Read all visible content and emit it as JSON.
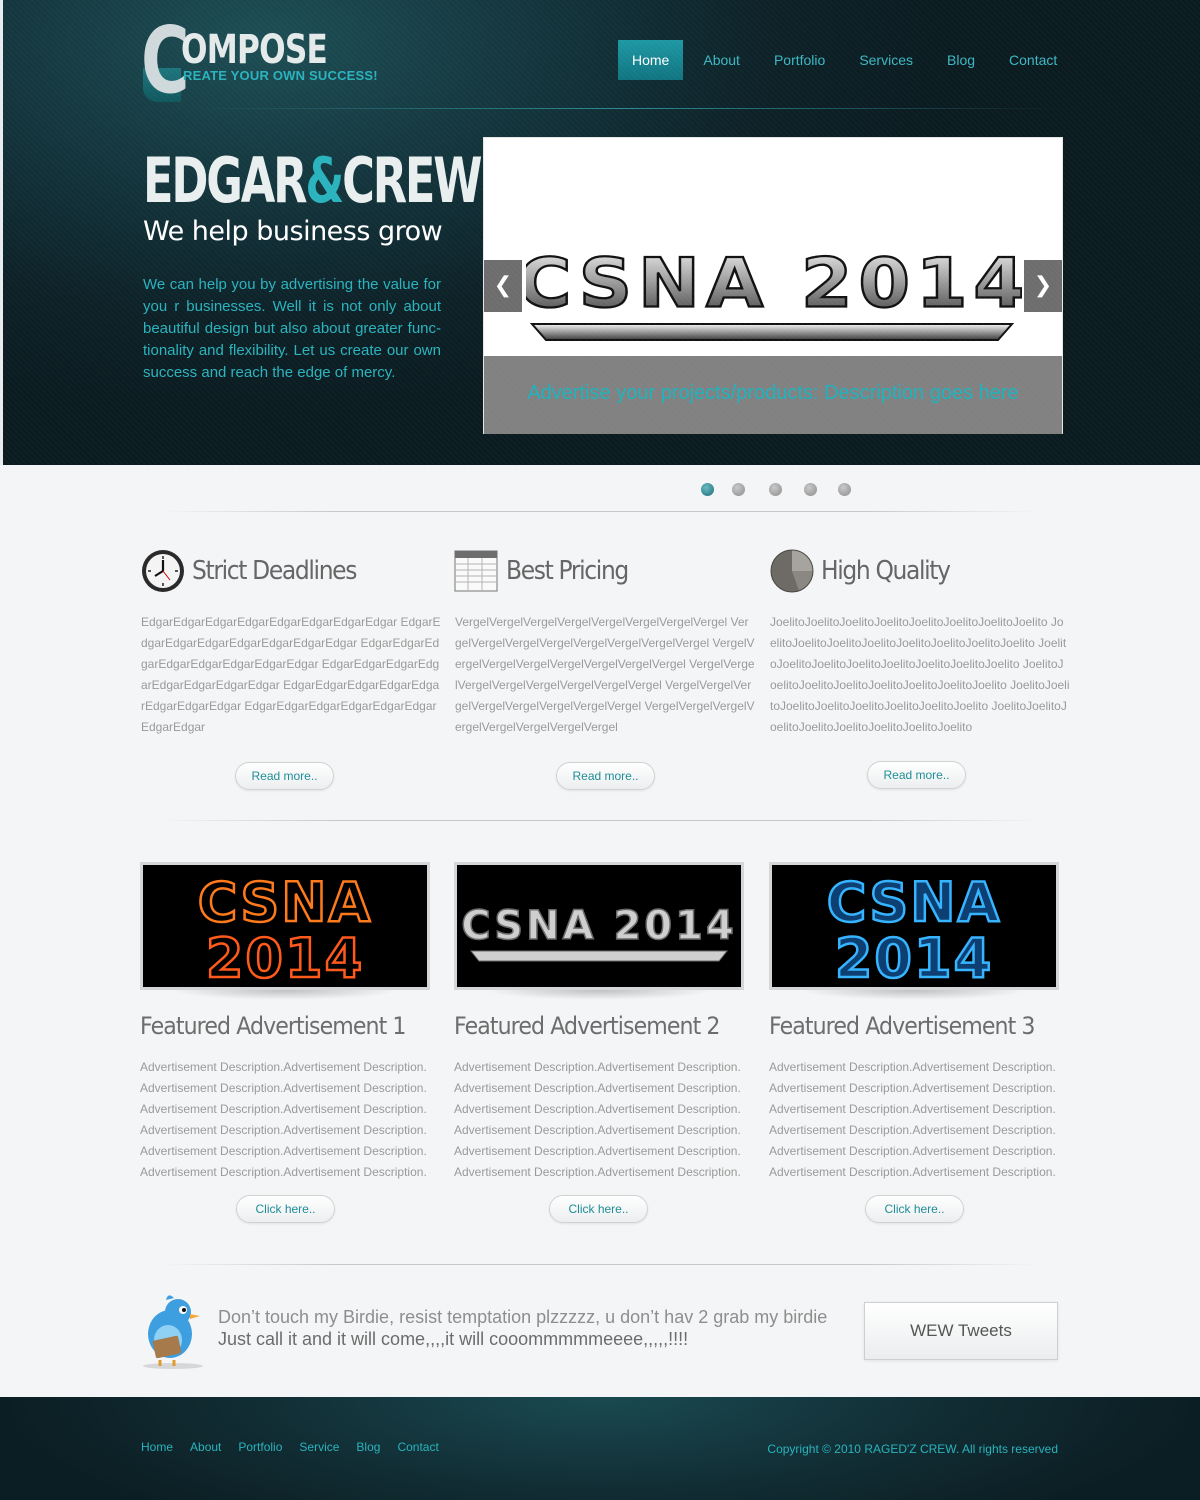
{
  "brand": {
    "logo_letter": "C",
    "logo_rest": "OMPOSE",
    "tagline": "REATE YOUR OWN SUCCESS!"
  },
  "nav": {
    "items": [
      {
        "label": "Home",
        "active": true
      },
      {
        "label": "About",
        "active": false
      },
      {
        "label": "Portfolio",
        "active": false
      },
      {
        "label": "Services",
        "active": false
      },
      {
        "label": "Blog",
        "active": false
      },
      {
        "label": "Contact",
        "active": false
      }
    ]
  },
  "hero": {
    "title_left": "EDGAR",
    "title_amp": "&",
    "title_right": "CREW",
    "subtitle": "We help business grow",
    "body": "We can help you by advertising the value for you r businesses.  Well  it  is not only  about beautiful design but also about greater func- tionality and flexibility. Let us create our own success and reach the edge of mercy."
  },
  "slider": {
    "image_text": "CSNA 2014",
    "caption": "Advertise your projects/products: Description goes here",
    "prev_glyph": "❮",
    "next_glyph": "❯",
    "slide_count": 5,
    "active_slide": 1
  },
  "features": [
    {
      "icon": "clock-icon",
      "title": "Strict Deadlines",
      "body": "EdgarEdgarEdgarEdgarEdgarEdgarEdgarEdgar EdgarEdgarEdgarEdgarEdgarEdgarEdgarEdgar EdgarEdgarEdgarEdgarEdgarEdgarEdgarEdgar EdgarEdgarEdgarEdgarEdgarEdgarEdgarEdgar EdgarEdgarEdgarEdgarEdgarEdgarEdgarEdgar EdgarEdgarEdgarEdgarEdgarEdgarEdgarEdgar",
      "button": "Read more.."
    },
    {
      "icon": "spreadsheet-icon",
      "title": "Best Pricing",
      "body": "VergelVergelVergelVergelVergelVergelVergelVergel VergelVergelVergelVergelVergelVergelVergelVergel VergelVergelVergelVergelVergelVergelVergelVergel VergelVergelVergelVergelVergelVergelVergelVergel VergelVergelVergelVergelVergelVergelVergelVergel VergelVergelVergelVergelVergelVergelVergelVergel",
      "button": "Read more.."
    },
    {
      "icon": "pie-chart-icon",
      "title": "High Quality",
      "body": "JoelitoJoelitoJoelitoJoelitoJoelitoJoelitoJoelitoJoelito JoelitoJoelitoJoelitoJoelitoJoelitoJoelitoJoelitoJoelito JoelitoJoelitoJoelitoJoelitoJoelitoJoelitoJoelitoJoelito JoelitoJoelitoJoelitoJoelitoJoelitoJoelitoJoelitoJoelito JoelitoJoelitoJoelitoJoelitoJoelitoJoelitoJoelitoJoelito JoelitoJoelitoJoelitoJoelitoJoelitoJoelitoJoelitoJoelito",
      "button": "Read more.."
    }
  ],
  "ads": [
    {
      "image_line1": "CSNA",
      "image_line2": "2014",
      "image_color": "#ff7a1c",
      "title": "Featured  Advertisement 1",
      "desc": "Advertisement Description.Advertisement Description. Advertisement Description.Advertisement Description. Advertisement Description.Advertisement Description. Advertisement Description.Advertisement Description. Advertisement Description.Advertisement Description. Advertisement Description.Advertisement Description.",
      "button": "Click here.."
    },
    {
      "image_line1": "CSNA 2014",
      "image_line2": "",
      "image_color": "#d9d9d9",
      "title": "Featured  Advertisement 2",
      "desc": "Advertisement Description.Advertisement Description. Advertisement Description.Advertisement Description. Advertisement Description.Advertisement Description. Advertisement Description.Advertisement Description. Advertisement Description.Advertisement Description. Advertisement Description.Advertisement Description.",
      "button": "Click here.."
    },
    {
      "image_line1": "CSNA",
      "image_line2": "2014",
      "image_color": "#2aa8ff",
      "title": "Featured  Advertisement 3",
      "desc": "Advertisement Description.Advertisement Description. Advertisement Description.Advertisement Description. Advertisement Description.Advertisement Description. Advertisement Description.Advertisement Description. Advertisement Description.Advertisement Description. Advertisement Description.Advertisement Description.",
      "button": "Click here.."
    }
  ],
  "tweet": {
    "line1": "Don’t touch my Birdie, resist temptation plzzzzz, u don’t hav 2 grab my birdie",
    "line2": "Just call it and it will come,,,,it will cooommmmmeeee,,,,,!!!!",
    "button": "WEW Tweets",
    "icon": "twitter-bird-icon"
  },
  "footer": {
    "links": [
      "Home",
      "About",
      "Portfolio",
      "Service",
      "Blog",
      "Contact"
    ],
    "copyright": "Copyright  ©  2010 RAGED'Z CREW. All rights reserved"
  },
  "colors": {
    "accent": "#2ab3bd",
    "header_dark": "#0c2026",
    "nav_active": "#1e98a4"
  }
}
